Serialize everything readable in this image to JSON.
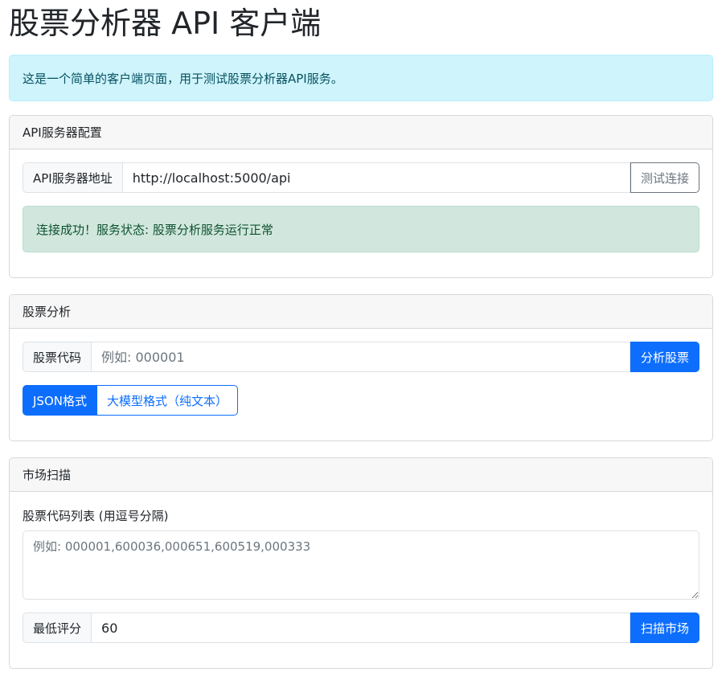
{
  "header": {
    "title": "股票分析器 API 客户端"
  },
  "intro_alert": {
    "text": "这是一个简单的客户端页面，用于测试股票分析器API服务。"
  },
  "server_config": {
    "title": "API服务器配置",
    "address_label": "API服务器地址",
    "address_value": "http://localhost:5000/api",
    "test_button": "测试连接",
    "status_text": "连接成功！服务状态: 股票分析服务运行正常"
  },
  "stock_analysis": {
    "title": "股票分析",
    "code_label": "股票代码",
    "code_placeholder": "例如: 000001",
    "analyze_button": "分析股票",
    "format_json": "JSON格式",
    "format_llm": "大模型格式（纯文本）"
  },
  "market_scan": {
    "title": "市场扫描",
    "list_label": "股票代码列表 (用逗号分隔)",
    "list_placeholder": "例如: 000001,600036,000651,600519,000333",
    "min_score_label": "最低评分",
    "min_score_value": "60",
    "scan_button": "扫描市场"
  }
}
